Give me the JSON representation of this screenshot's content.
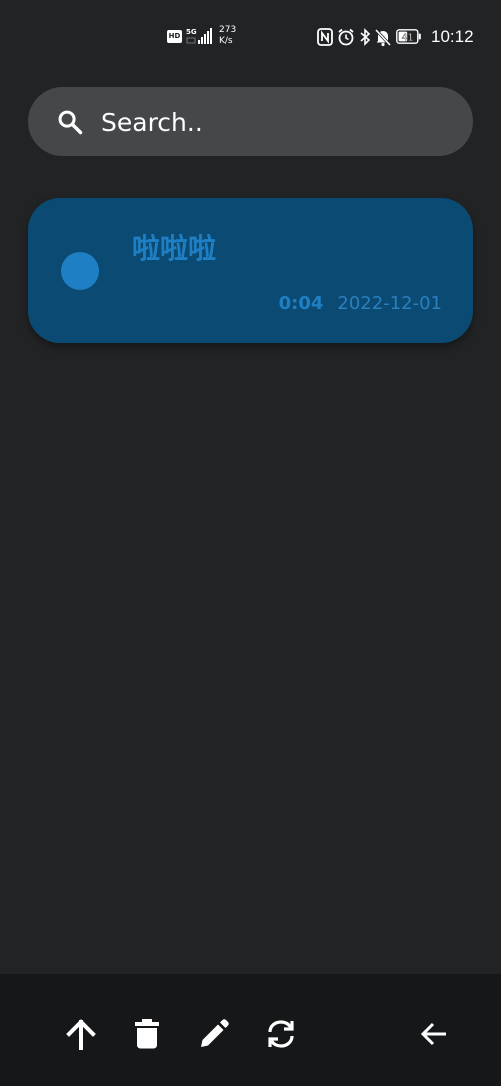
{
  "status_bar": {
    "hd_label": "HD",
    "network_label": "5G",
    "speed_value": "273",
    "speed_unit": "K/s",
    "battery_level": "41",
    "time": "10:12"
  },
  "search": {
    "placeholder": "Search.."
  },
  "recordings": [
    {
      "title": "啦啦啦",
      "duration": "0:04",
      "date": "2022-12-01"
    }
  ],
  "colors": {
    "background": "#222325",
    "search_bg": "#464749",
    "card_bg": "#0b4a72",
    "accent": "#1f7fc4",
    "bottom_bar_bg": "#161718"
  },
  "bottom_bar": {
    "icons": [
      "arrow-up-icon",
      "trash-icon",
      "pencil-icon",
      "sync-icon",
      "arrow-left-icon"
    ]
  }
}
